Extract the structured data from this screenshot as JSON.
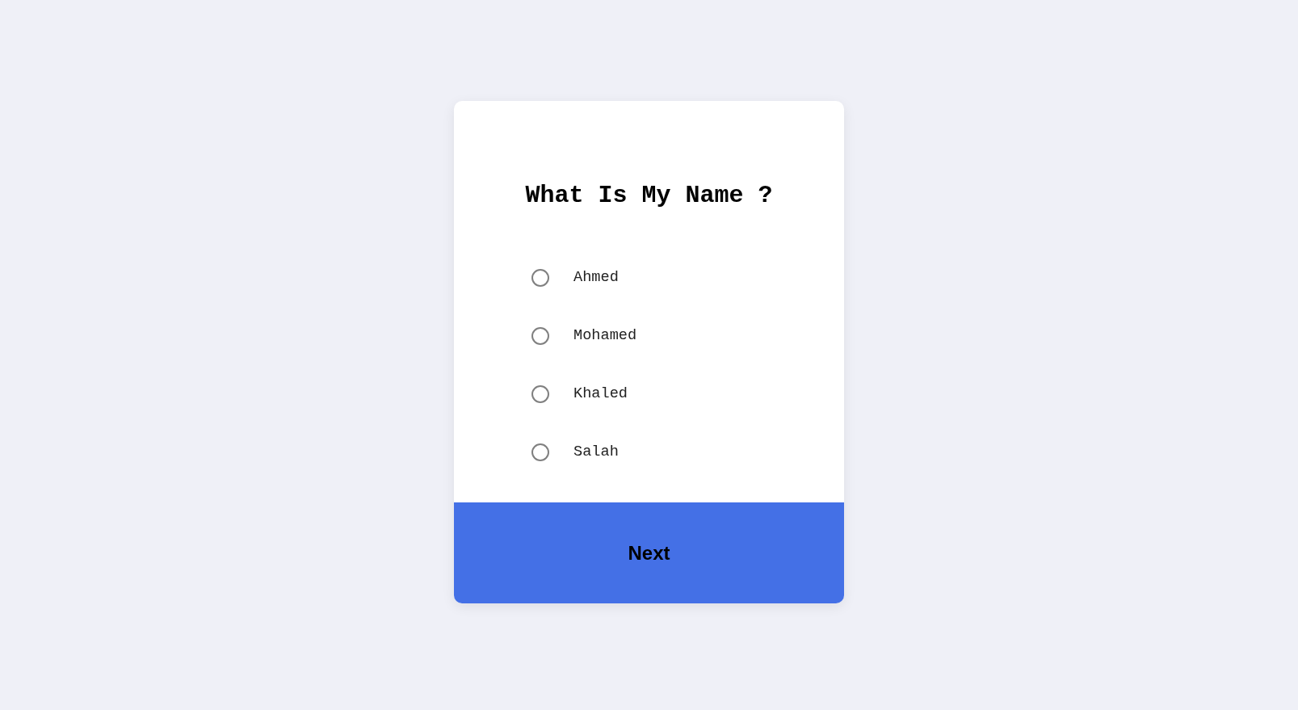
{
  "quiz": {
    "question": "What Is My Name ?",
    "options": [
      {
        "label": "Ahmed",
        "selected": false
      },
      {
        "label": "Mohamed",
        "selected": false
      },
      {
        "label": "Khaled",
        "selected": false
      },
      {
        "label": "Salah",
        "selected": false
      }
    ],
    "next_button": {
      "label": "Next"
    }
  }
}
